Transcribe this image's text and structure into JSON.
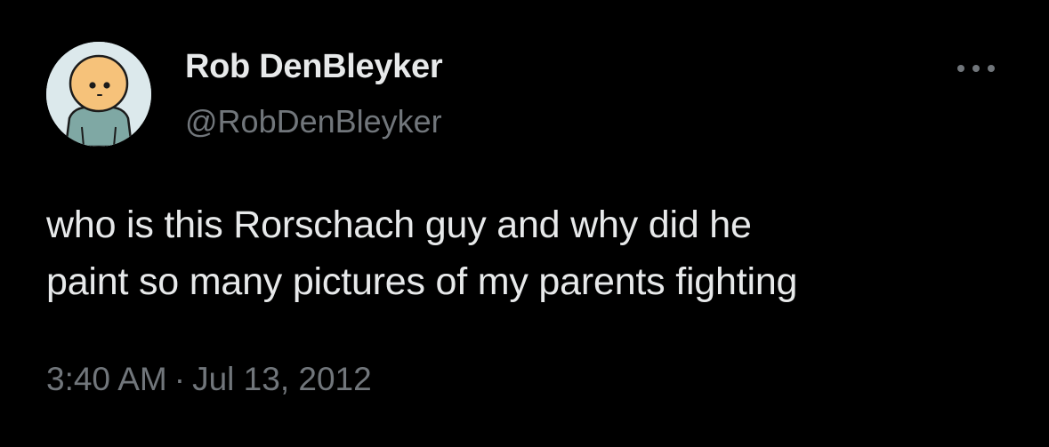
{
  "tweet": {
    "author": {
      "display_name": "Rob DenBleyker",
      "handle": "@RobDenBleyker",
      "avatar_icon": "cartoon-character-avatar"
    },
    "more_icon": "more-dots-icon",
    "text_lines": [
      "who is this Rorschach guy and why did he",
      "paint so many pictures of my parents fighting"
    ],
    "time": "3:40 AM",
    "separator": "·",
    "date": "Jul 13, 2012"
  },
  "colors": {
    "background": "#000000",
    "primary_text": "#e7e9ea",
    "secondary_text": "#71767b",
    "avatar_bg": "#dce9ec",
    "avatar_skin": "#f6c27a",
    "avatar_shirt": "#7fa8a4"
  }
}
